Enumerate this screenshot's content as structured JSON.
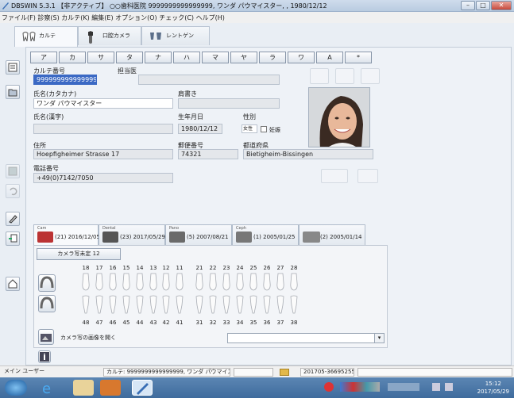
{
  "window": {
    "title": "DBSWIN 5.3.1 【非アクティブ】 ○○歯科医院 9999999999999999, ワンダ パウマイスター, , 1980/12/12"
  },
  "menu": {
    "text": "ファイル(F) 診察(S) カルテ(K) 編集(E) オプション(O) チェック(C) ヘルプ(H)"
  },
  "tabs": [
    {
      "label": "カルテ"
    },
    {
      "label": "口腔カメラ"
    },
    {
      "label": "レントゲン"
    }
  ],
  "kana": [
    "ア",
    "カ",
    "サ",
    "タ",
    "ナ",
    "ハ",
    "マ",
    "ヤ",
    "ラ",
    "ワ",
    "A",
    "*"
  ],
  "patient": {
    "chart_no_label": "カルテ番号",
    "chart_no": "9999999999999999",
    "doctor_label": "担当医",
    "doctor": "",
    "kana_name_label": "氏名(カタカナ)",
    "kana_name": "ワンダ パウマイスター",
    "title_label": "肩書き",
    "title": "",
    "kanji_name_label": "氏名(漢字)",
    "kanji_name": "",
    "birth_label": "生年月日",
    "birth": "1980/12/12",
    "sex_label": "性別",
    "sex": "女性",
    "pregnant_label": "妊娠",
    "address_label": "住所",
    "address": "Hoepfigheimer Strasse 17",
    "zip_label": "郵便番号",
    "zip": "74321",
    "pref_label": "都道府県",
    "pref": "Bietigheim-Bissingen",
    "phone_label": "電話番号",
    "phone": "+49(0)7142/7050"
  },
  "image_tabs": [
    {
      "small": "Cam",
      "text": "(21) 2016/12/05"
    },
    {
      "small": "Dental",
      "text": "(23) 2017/05/29"
    },
    {
      "small": "Pano",
      "text": "(5) 2007/08/21"
    },
    {
      "small": "Ceph",
      "text": "(1) 2005/01/25"
    },
    {
      "small": "",
      "text": "(2) 2005/01/14"
    }
  ],
  "camera": {
    "count_label": "カメラ写未定 12",
    "open_label": "カメラ写の画像を開く",
    "dropdown_value": ""
  },
  "teeth": {
    "upper": [
      "18",
      "17",
      "16",
      "15",
      "14",
      "13",
      "12",
      "11",
      "21",
      "22",
      "23",
      "24",
      "25",
      "26",
      "27",
      "28"
    ],
    "lower": [
      "48",
      "47",
      "46",
      "45",
      "44",
      "43",
      "42",
      "41",
      "31",
      "32",
      "33",
      "34",
      "35",
      "36",
      "37",
      "38"
    ]
  },
  "status": {
    "user": "メイン ユーザー",
    "empty1": "",
    "patient": "カルテ: 9999999999999999, ワンダ パウマイスター, , 1980/12/12",
    "code": "201705-36695255",
    "empty2": ""
  },
  "clock": {
    "time": "15:12",
    "date": "2017/05/29"
  }
}
